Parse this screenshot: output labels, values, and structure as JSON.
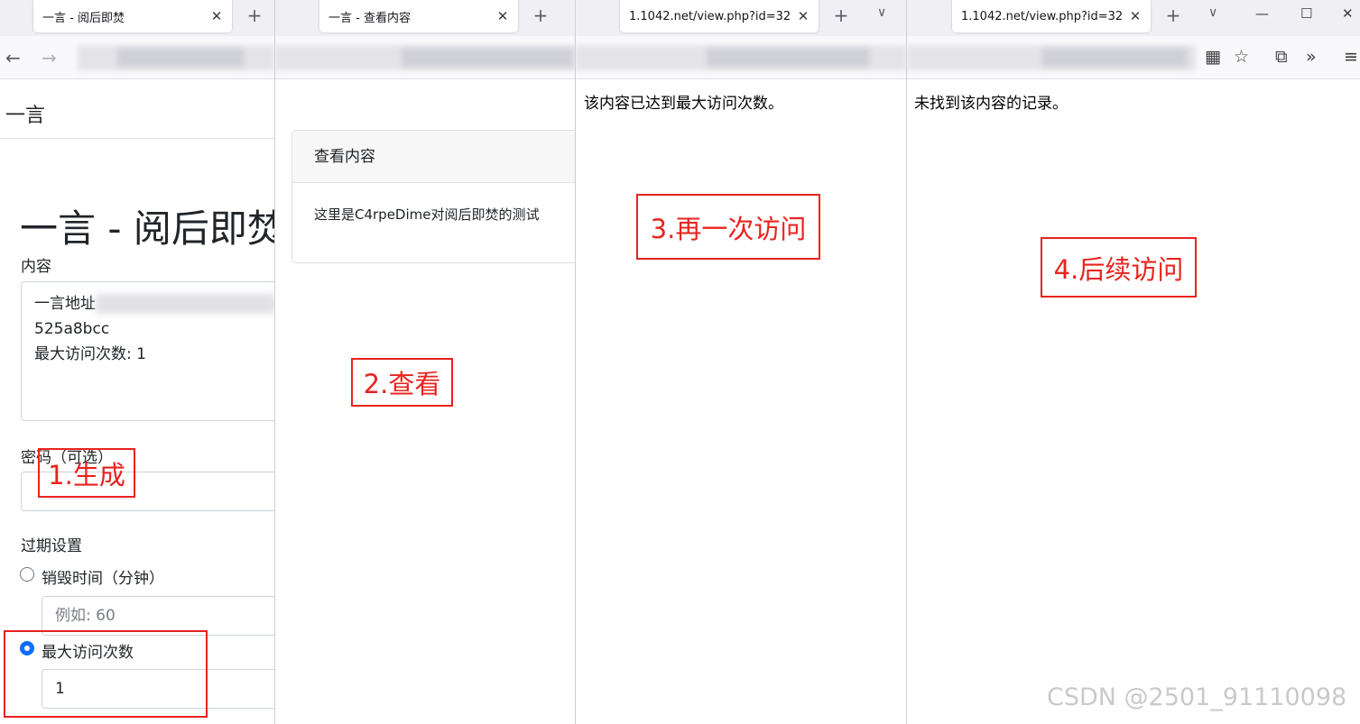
{
  "panel1": {
    "tab_title": "一言 - 阅后即焚",
    "brand": "一言",
    "heading": "一言 - 阅后即焚",
    "content_label": "内容",
    "content_lines": [
      "一言地址",
      "525a8bcc",
      "最大访问次数: 1"
    ],
    "password_label": "密码（可选）",
    "expiry_label": "过期设置",
    "option_minutes_label": "销毁时间（分钟）",
    "minutes_placeholder": "例如: 60",
    "option_visits_label": "最大访问次数",
    "visits_value": "1"
  },
  "panel2": {
    "tab_title": "一言 - 查看内容",
    "card_header": "查看内容",
    "card_body": "这里是C4rpeDime对阅后即焚的测试"
  },
  "panel3": {
    "tab_title": "1.1042.net/view.php?id=32",
    "message": "该内容已达到最大访问次数。"
  },
  "panel4": {
    "tab_title": "1.1042.net/view.php?id=32",
    "message": "未找到该内容的记录。"
  },
  "annotations": [
    "1.生成",
    "2.查看",
    "3.再一次访问",
    "4.后续访问"
  ],
  "watermark": "CSDN @2501_91110098",
  "icons": {
    "close": "close-icon",
    "new_tab": "plus-icon",
    "back": "back-arrow-icon",
    "forward": "forward-arrow-icon",
    "tab_list": "chevron-down-icon",
    "qr": "qr-code-icon",
    "bookmark": "star-icon",
    "extensions": "puzzle-icon",
    "overflow": "double-chevron-icon",
    "menu": "hamburger-icon"
  },
  "colors": {
    "annotation": "#e8231e",
    "radio_checked": "#0d6efd",
    "tabstrip": "#f0f0f4",
    "toolbar": "#f9f9fb"
  }
}
